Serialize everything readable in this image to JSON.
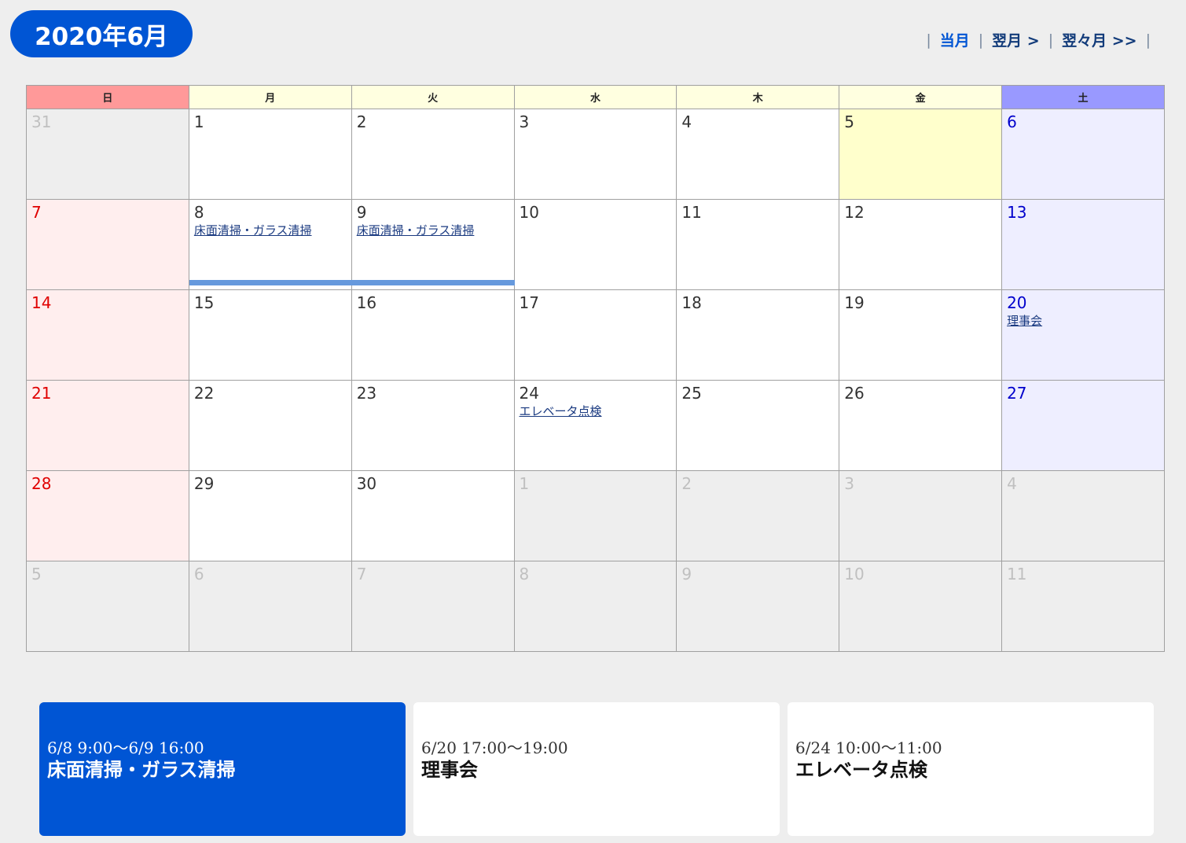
{
  "header": {
    "title": "2020年6月",
    "nav": [
      {
        "label": "当月",
        "current": true
      },
      {
        "label": "翌月 >",
        "current": false
      },
      {
        "label": "翌々月 >>",
        "current": false
      }
    ],
    "separator": "|"
  },
  "calendar": {
    "weekdays": [
      "日",
      "月",
      "火",
      "水",
      "木",
      "金",
      "土"
    ],
    "weeks": [
      [
        {
          "day": "31",
          "kind": "other"
        },
        {
          "day": "1"
        },
        {
          "day": "2"
        },
        {
          "day": "3"
        },
        {
          "day": "4"
        },
        {
          "day": "5",
          "kind": "today"
        },
        {
          "day": "6"
        }
      ],
      [
        {
          "day": "7"
        },
        {
          "day": "8",
          "event": "床面清掃・ガラス清掃",
          "bar": true
        },
        {
          "day": "9",
          "event": "床面清掃・ガラス清掃",
          "bar": true
        },
        {
          "day": "10"
        },
        {
          "day": "11"
        },
        {
          "day": "12"
        },
        {
          "day": "13"
        }
      ],
      [
        {
          "day": "14"
        },
        {
          "day": "15"
        },
        {
          "day": "16"
        },
        {
          "day": "17"
        },
        {
          "day": "18"
        },
        {
          "day": "19"
        },
        {
          "day": "20",
          "event": "理事会"
        }
      ],
      [
        {
          "day": "21"
        },
        {
          "day": "22"
        },
        {
          "day": "23"
        },
        {
          "day": "24",
          "event": "エレベータ点検"
        },
        {
          "day": "25"
        },
        {
          "day": "26"
        },
        {
          "day": "27"
        }
      ],
      [
        {
          "day": "28"
        },
        {
          "day": "29"
        },
        {
          "day": "30"
        },
        {
          "day": "1",
          "kind": "other"
        },
        {
          "day": "2",
          "kind": "other"
        },
        {
          "day": "3",
          "kind": "other"
        },
        {
          "day": "4",
          "kind": "other"
        }
      ],
      [
        {
          "day": "5",
          "kind": "other"
        },
        {
          "day": "6",
          "kind": "other"
        },
        {
          "day": "7",
          "kind": "other"
        },
        {
          "day": "8",
          "kind": "other"
        },
        {
          "day": "9",
          "kind": "other"
        },
        {
          "day": "10",
          "kind": "other"
        },
        {
          "day": "11",
          "kind": "other"
        }
      ]
    ]
  },
  "events": [
    {
      "when": "6/8 9:00〜6/9 16:00",
      "name": "床面清掃・ガラス清掃",
      "active": true
    },
    {
      "when": "6/20 17:00〜19:00",
      "name": "理事会",
      "active": false
    },
    {
      "when": "6/24 10:00〜11:00",
      "name": "エレベータ点検",
      "active": false
    }
  ],
  "colors": {
    "accent": "#0055d4",
    "sunday_header": "#ff9999",
    "saturday_header": "#9999ff",
    "weekday_header": "#ffffe0",
    "today": "#ffffcc",
    "event_bar": "#6699dd"
  }
}
